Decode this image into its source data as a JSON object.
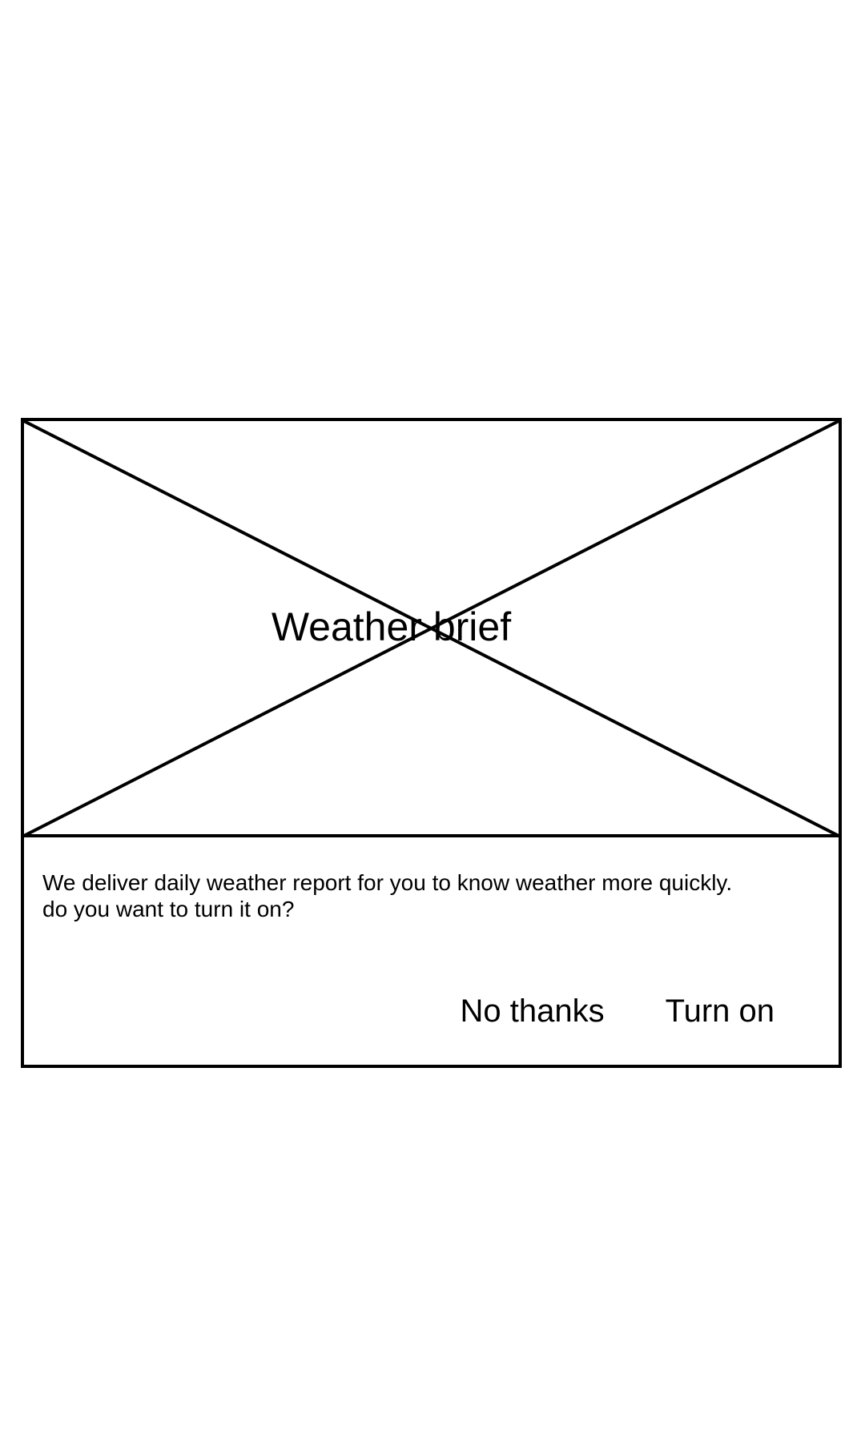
{
  "dialog": {
    "image_label": "Weather brief",
    "message": "We deliver daily weather report for you to know weather more quickly. do you want to turn it on?",
    "buttons": {
      "decline": "No thanks",
      "accept": "Turn on"
    }
  }
}
